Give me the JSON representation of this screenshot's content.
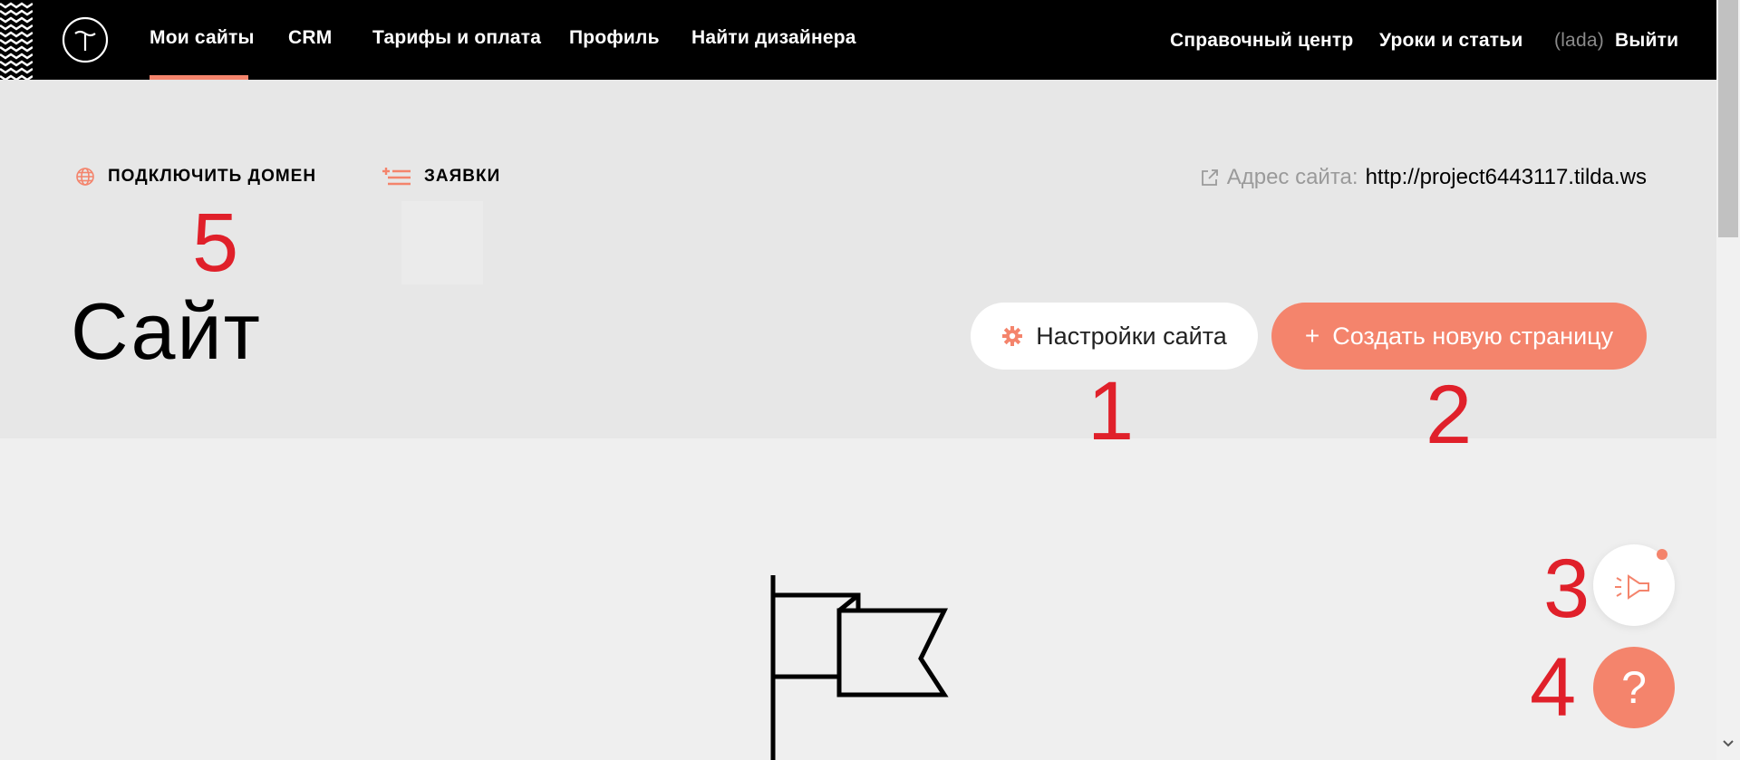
{
  "topnav": {
    "items": [
      "Мои сайты",
      "CRM",
      "Тарифы и оплата",
      "Профиль",
      "Найти дизайнера"
    ],
    "right_items": [
      "Справочный центр",
      "Уроки и статьи"
    ],
    "username": "(lada)",
    "logout": "Выйти"
  },
  "header": {
    "connect_domain": "ПОДКЛЮЧИТЬ ДОМЕН",
    "leads": "ЗАЯВКИ",
    "site_address_label": "Адрес сайта:",
    "site_address_url": "http://project6443117.tilda.ws",
    "page_title": "Сайт"
  },
  "buttons": {
    "settings": "Настройки сайта",
    "create_page": "Создать новую страницу",
    "create_plus": "+",
    "help": "?"
  },
  "annotations": [
    "1",
    "2",
    "3",
    "4",
    "5"
  ],
  "colors": {
    "accent": "#f4846c",
    "annotation": "#e0202a",
    "topbar": "#000000",
    "header_bg": "#e7e7e7",
    "page_bg": "#efefef"
  },
  "icons": [
    "logo-icon",
    "globe-icon",
    "leads-list-icon",
    "external-link-icon",
    "gear-icon",
    "megaphone-icon",
    "flag-icon"
  ]
}
